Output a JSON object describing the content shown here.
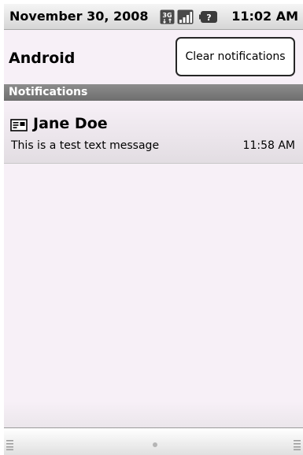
{
  "status_bar": {
    "date": "November 30, 2008",
    "time": "11:02 AM",
    "icons": [
      "3g-icon",
      "signal-icon",
      "battery-icon"
    ]
  },
  "header": {
    "title": "Android",
    "clear_button_label": "Clear notifications"
  },
  "section": {
    "label": "Notifications"
  },
  "notifications": [
    {
      "icon": "message-icon",
      "sender": "Jane Doe",
      "text": "This is a test text message",
      "time": "11:58 AM"
    }
  ],
  "colors": {
    "background": "#f7f0f7",
    "section_header": "#7d7d7d"
  }
}
